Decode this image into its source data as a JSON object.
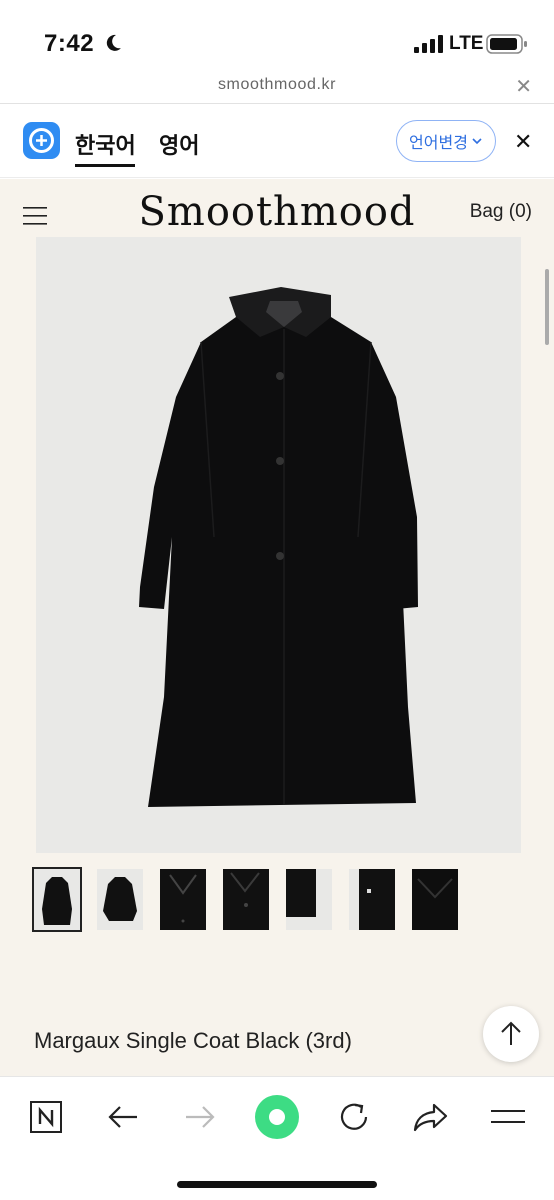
{
  "status_bar": {
    "time": "7:42",
    "network": "LTE"
  },
  "url_bar": {
    "domain": "smoothmood.kr"
  },
  "translate_bar": {
    "source_lang": "한국어",
    "target_lang": "영어",
    "change_language_label": "언어변경"
  },
  "header": {
    "brand": "Smoothmood",
    "bag_label": "Bag (0)"
  },
  "product": {
    "title": "Margaux Single Coat Black (3rd)",
    "thumbnail_count": 7,
    "selected_thumbnail": 1
  },
  "colors": {
    "page_bg": "#f7f3ec",
    "accent_blue": "#2f8cf2",
    "browser_green": "#3ddc84"
  },
  "toolbar": {
    "icons": [
      "naver-n-icon",
      "back-arrow-icon",
      "forward-arrow-icon",
      "green-dot-icon",
      "reload-icon",
      "share-icon",
      "menu-icon"
    ]
  }
}
